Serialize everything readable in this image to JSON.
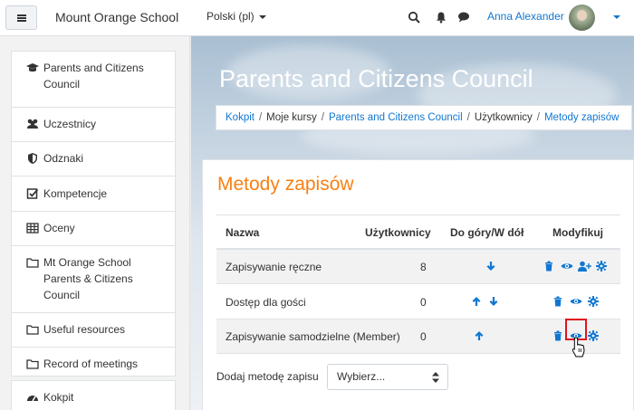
{
  "navbar": {
    "brand": "Mount Orange School",
    "language": "Polski (pl)",
    "username": "Anna Alexander"
  },
  "drawer": {
    "items": [
      {
        "label": "Parents and Citizens Council",
        "icon": "graduation-cap-icon"
      },
      {
        "label": "Uczestnicy",
        "icon": "users-icon"
      },
      {
        "label": "Odznaki",
        "icon": "shield-icon"
      },
      {
        "label": "Kompetencje",
        "icon": "check-square-icon"
      },
      {
        "label": "Oceny",
        "icon": "table-icon"
      },
      {
        "label": "Mt Orange School Parents & Citizens Council",
        "icon": "folder-icon"
      },
      {
        "label": "Useful resources",
        "icon": "folder-icon"
      },
      {
        "label": "Record of meetings",
        "icon": "folder-icon"
      },
      {
        "label": "Kokpit",
        "icon": "dashboard-icon"
      }
    ]
  },
  "page": {
    "heading": "Parents and Citizens Council",
    "breadcrumb": [
      "Kokpit",
      "Moje kursy",
      "Parents and Citizens Council",
      "Użytkownicy",
      "Metody zapisów"
    ],
    "card_title": "Metody zapisów"
  },
  "table": {
    "headers": {
      "name": "Nazwa",
      "users": "Użytkownicy",
      "order": "Do góry/W dół",
      "edit": "Modyfikuj"
    },
    "rows": [
      {
        "name": "Zapisywanie ręczne",
        "users": "8",
        "arrows": [
          "down"
        ],
        "actions": [
          "delete",
          "view",
          "enrol-users",
          "settings"
        ]
      },
      {
        "name": "Dostęp dla gości",
        "users": "0",
        "arrows": [
          "up",
          "down"
        ],
        "actions": [
          "delete",
          "view",
          "settings"
        ]
      },
      {
        "name": "Zapisywanie samodzielne (Member)",
        "users": "0",
        "arrows": [
          "up"
        ],
        "actions": [
          "delete",
          "view",
          "settings"
        ]
      }
    ]
  },
  "add_method": {
    "label": "Dodaj metodę zapisu",
    "selected": "Wybierz..."
  },
  "colors": {
    "accent": "#f98012",
    "link": "#1177d1",
    "highlight": "#e0141e"
  }
}
